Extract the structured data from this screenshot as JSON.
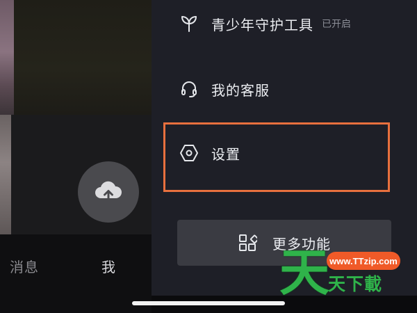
{
  "bottom_nav": {
    "messages_label": "消息",
    "me_label": "我"
  },
  "upload_button": {
    "icon": "cloud-upload-icon"
  },
  "drawer": {
    "items": [
      {
        "label": "青少年守护工具",
        "badge": "已开启",
        "icon": "sprout-icon"
      },
      {
        "label": "我的客服",
        "icon": "headset-icon"
      },
      {
        "label": "设置",
        "icon": "hexagon-settings-icon"
      }
    ],
    "more_button": {
      "label": "更多功能",
      "icon": "grid-shapes-icon"
    }
  },
  "highlight_color": "#e8703e",
  "watermark": {
    "url": "www.TTzip.com",
    "big_char": "天",
    "small_text": "天下載"
  }
}
